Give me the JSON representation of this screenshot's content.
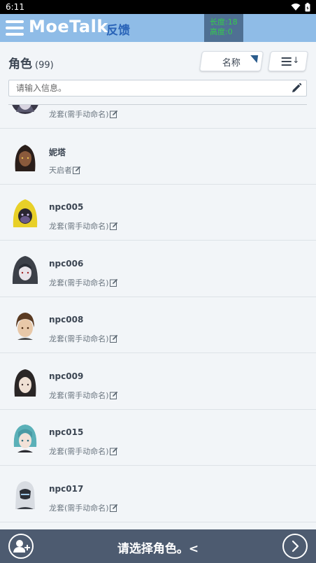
{
  "statusbar": {
    "time": "6:11"
  },
  "appbar": {
    "brand": "MoeTalk",
    "feedback": "反馈",
    "counter_line1": "长度:18",
    "counter_line2": "高度:0"
  },
  "header": {
    "title": "角色",
    "count": "(99)",
    "sort_label": "名称",
    "order_arrow": "↓"
  },
  "search": {
    "placeholder": "请输入信息。"
  },
  "characters": [
    {
      "name": "",
      "sub": "龙套(需手动命名)"
    },
    {
      "name": "妮塔",
      "sub": "天启者"
    },
    {
      "name": "npc005",
      "sub": "龙套(需手动命名)"
    },
    {
      "name": "npc006",
      "sub": "龙套(需手动命名)"
    },
    {
      "name": "npc008",
      "sub": "龙套(需手动命名)"
    },
    {
      "name": "npc009",
      "sub": "龙套(需手动命名)"
    },
    {
      "name": "npc015",
      "sub": "龙套(需手动命名)"
    },
    {
      "name": "npc017",
      "sub": "龙套(需手动命名)"
    }
  ],
  "bottombar": {
    "prompt": "请选择角色。<"
  },
  "colors": {
    "appbar": "#8fbce7",
    "bottombar": "#4d5b70",
    "accent": "#2a64b8",
    "background": "#f2f5f8"
  },
  "icons": [
    "menu-icon",
    "wifi-icon",
    "battery-icon",
    "sort-triangle-icon",
    "sort-order-icon",
    "pencil-icon",
    "edit-icon",
    "add-user-icon",
    "chevron-right-icon"
  ]
}
